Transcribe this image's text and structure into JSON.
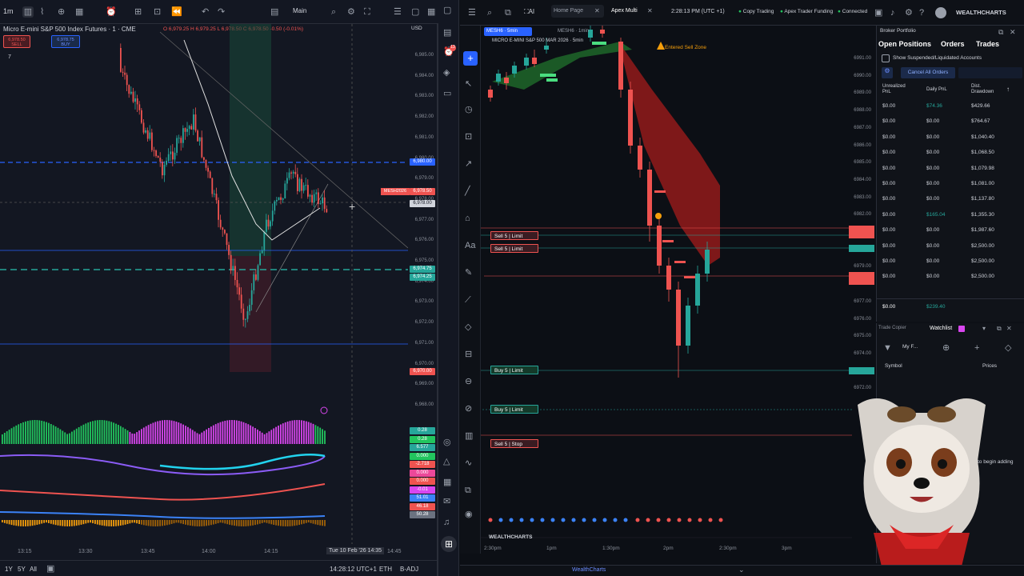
{
  "left": {
    "toolbar": {
      "interval": "1m",
      "layout": "Main"
    },
    "symbol_title": "Micro E-mini S&P 500 Index Futures · 1 · CME",
    "ohlc": "O 6,979.25 H 6,979.25 L 6,978.50 C 6,978.50 -0.50 (-0.01%)",
    "sell_label": "6,978.50 SELL",
    "buy_label": "6,978.75 BUY",
    "qty": "7",
    "currency": "USD",
    "price_levels": [
      "6,985.00",
      "6,984.00",
      "6,983.00",
      "6,982.00",
      "6,981.00",
      "6,980.00",
      "6,979.00",
      "6,978.00",
      "6,977.00",
      "6,976.00",
      "6,975.00",
      "6,974.00",
      "6,973.00",
      "6,972.00",
      "6,971.00",
      "6,970.00",
      "6,969.00",
      "6,968.00"
    ],
    "tags": {
      "blue": "6,980.00",
      "red_symbol": "MESH2026",
      "red_price": "6,978.50",
      "cursor": "6,978.00",
      "green1": "6,974.75",
      "green2": "6,974.25",
      "red_low": "6,970.00"
    },
    "indicator_vals": [
      "0.28",
      "0.28",
      "6.577",
      "0.000",
      "-2.718",
      "0.000",
      "0.000",
      "-0.01",
      "51.01",
      "46.18",
      "50.28"
    ],
    "time_ticks": [
      "13:15",
      "13:30",
      "13:45",
      "14:00",
      "14:15",
      "14:45"
    ],
    "time_hover": "Tue 10 Feb '26  14:35",
    "bottom": {
      "ranges": [
        "1Y",
        "5Y",
        "All"
      ],
      "clock": "14:28:12 UTC+1",
      "session": "ETH",
      "adj": "B-ADJ"
    }
  },
  "right": {
    "tabs": [
      "Home Page",
      "Apex Multi"
    ],
    "clock": "2:28:13 PM (UTC +1)",
    "badges": [
      "Copy Trading",
      "Apex Trader Funding",
      "Connected"
    ],
    "brand": "WEALTHCHARTS",
    "chart_tab1": "MESH6 · 5min",
    "chart_tab2": "MESH6 · 1min",
    "chart_title": "MICRO E-MINI S&P 500 MAR 2026 · 5min",
    "entered_zone": "Entered Sell Zone",
    "orders": [
      {
        "label": "Sell 5 | Limit",
        "type": "sell"
      },
      {
        "label": "Sell 5 | Limit",
        "type": "sell"
      },
      {
        "label": "Buy 5 | Limit",
        "type": "buy"
      },
      {
        "label": "Buy 5 | Limit",
        "type": "buy"
      },
      {
        "label": "Sell 5 | Stop",
        "type": "stop"
      }
    ],
    "price_levels": [
      "6991.00",
      "6990.00",
      "6989.00",
      "6988.00",
      "6987.00",
      "6986.00",
      "6985.00",
      "6984.00",
      "6983.00",
      "6982.00",
      "6981.00",
      "6980.00",
      "6979.00",
      "6978.00",
      "6977.00",
      "6976.00",
      "6975.00",
      "6974.00",
      "6973.00",
      "6972.00"
    ],
    "time_ticks": [
      "2:30pm",
      "1pm",
      "1:30pm",
      "2pm",
      "2:30pm",
      "3pm"
    ],
    "footer": "WealthCharts",
    "portfolio": {
      "title": "Broker Portfolio",
      "tabs": [
        "Open Positions",
        "Orders",
        "Trades"
      ],
      "show_suspended": "Show Suspended/Liquidated Accounts",
      "cancel_all": "Cancel All Orders",
      "headers": [
        "Unrealized PnL",
        "Daily PnL",
        "Dist. Drawdown"
      ],
      "rows": [
        [
          "$0.00",
          "$74.36",
          "$429.66"
        ],
        [
          "$0.00",
          "$0.00",
          "$764.67"
        ],
        [
          "$0.00",
          "$0.00",
          "$1,040.40"
        ],
        [
          "$0.00",
          "$0.00",
          "$1,068.50"
        ],
        [
          "$0.00",
          "$0.00",
          "$1,079.98"
        ],
        [
          "$0.00",
          "$0.00",
          "$1,081.00"
        ],
        [
          "$0.00",
          "$0.00",
          "$1,137.80"
        ],
        [
          "$0.00",
          "$165.04",
          "$1,355.30"
        ],
        [
          "$0.00",
          "$0.00",
          "$1,987.60"
        ],
        [
          "$0.00",
          "$0.00",
          "$2,500.00"
        ],
        [
          "$0.00",
          "$0.00",
          "$2,500.00"
        ],
        [
          "$0.00",
          "$0.00",
          "$2,500.00"
        ]
      ],
      "total": [
        "$0.00",
        "$239.40"
      ]
    },
    "watchlist": {
      "copier": "Trade Copier",
      "title": "Watchlist",
      "list_name": "My F...",
      "headers": [
        "Symbol",
        "Prices"
      ],
      "hint": "to begin adding"
    }
  },
  "colors": {
    "up": "#26a69a",
    "down": "#ef5350",
    "blue": "#2962ff",
    "magenta": "#d946ef"
  }
}
